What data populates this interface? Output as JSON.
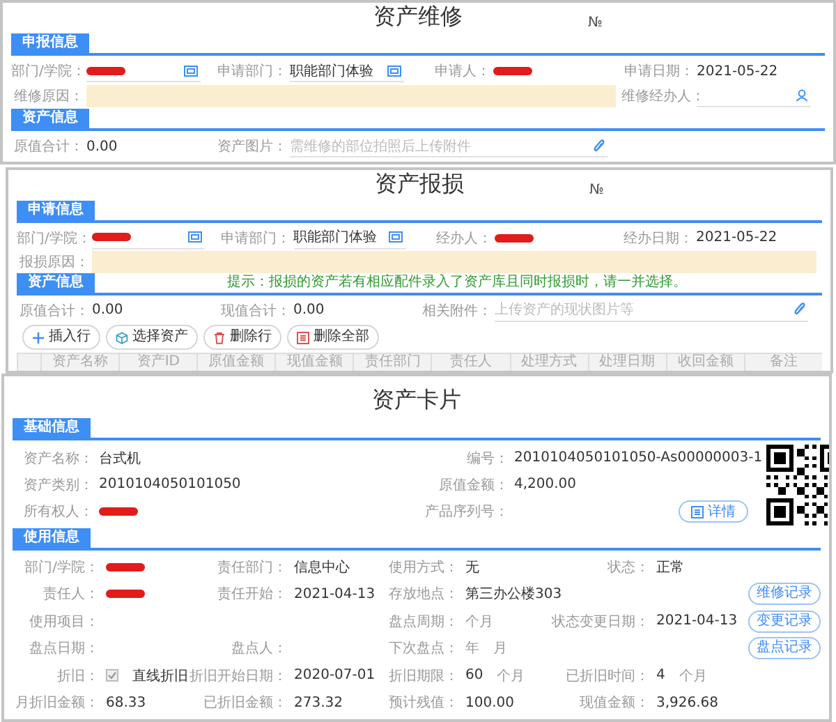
{
  "repair_form": {
    "title": "资产维修",
    "number_label": "№",
    "sections": [
      {
        "title": "申报信息",
        "rows": [
          {
            "fields": [
              {
                "label": "部门/学院：",
                "kind": "picker",
                "redacted": true
              },
              {
                "label": "申请部门：",
                "kind": "picker",
                "value": "职能部门体验"
              },
              {
                "label": "申请人：",
                "kind": "text",
                "redacted": true
              },
              {
                "label": "申请日期：",
                "kind": "text",
                "value": "2021-05-22"
              }
            ]
          },
          {
            "fields": [
              {
                "label": "维修原因：",
                "kind": "highlight"
              },
              {
                "label": "维修经办人：",
                "kind": "person"
              }
            ]
          }
        ]
      },
      {
        "title": "资产信息",
        "rows": [
          {
            "fields": [
              {
                "label": "原值合计：",
                "kind": "text",
                "value": "0.00"
              },
              {
                "label": "资产图片：",
                "kind": "attachment",
                "placeholder": "需维修的部位拍照后上传附件"
              }
            ]
          }
        ]
      }
    ]
  },
  "scrap_form": {
    "title": "资产报损",
    "number_label": "№",
    "sections": [
      {
        "title": "申请信息",
        "rows": [
          {
            "fields": [
              {
                "label": "部门/学院：",
                "kind": "picker",
                "redacted": true
              },
              {
                "label": "申请部门：",
                "kind": "picker",
                "value": "职能部门体验"
              },
              {
                "label": "经办人：",
                "kind": "text",
                "redacted": true
              },
              {
                "label": "经办日期：",
                "kind": "text",
                "value": "2021-05-22"
              }
            ]
          },
          {
            "fields": [
              {
                "label": "报损原因：",
                "kind": "highlight"
              }
            ]
          }
        ]
      },
      {
        "title": "资产信息",
        "hint": "提示：报损的资产若有相应配件录入了资产库且同时报损时，请一并选择。",
        "rows": [
          {
            "fields": [
              {
                "label": "原值合计：",
                "kind": "text",
                "value": "0.00"
              },
              {
                "label": "现值合计：",
                "kind": "text",
                "value": "0.00"
              },
              {
                "label": "相关附件：",
                "kind": "attachment",
                "placeholder": "上传资产的现状图片等"
              }
            ]
          }
        ]
      }
    ],
    "buttons": [
      {
        "label": "插入行",
        "kind": "add"
      },
      {
        "label": "选择资产",
        "kind": "select"
      },
      {
        "label": "删除行",
        "kind": "delete"
      },
      {
        "label": "删除全部",
        "kind": "delete_all"
      }
    ],
    "table": {
      "columns": [
        "资产名称",
        "资产ID",
        "原值金额",
        "现值金额",
        "责任部门",
        "责任人",
        "处理方式",
        "处理日期",
        "收回金额",
        "备注"
      ]
    }
  },
  "asset_card": {
    "title": "资产卡片",
    "basic": {
      "title": "基础信息",
      "rows": [
        [
          {
            "label": "资产名称：",
            "value": "台式机"
          },
          {
            "label": "编号：",
            "value": "2010104050101050-As00000003-1"
          }
        ],
        [
          {
            "label": "资产类别：",
            "value": "2010104050101050"
          },
          {
            "label": "原值金额：",
            "value": "4,200.00"
          }
        ],
        [
          {
            "label": "所有权人：",
            "redacted": true
          },
          {
            "label": "产品序列号："
          }
        ]
      ],
      "detail_button": "详情"
    },
    "usage": {
      "title": "使用信息",
      "rows": [
        {
          "fields": [
            {
              "label": "部门/学院：",
              "redacted": true
            },
            {
              "label": "责任部门：",
              "value": "信息中心"
            },
            {
              "label": "使用方式：",
              "value": "无"
            },
            {
              "label": "状态：",
              "value": "正常"
            }
          ]
        },
        {
          "fields": [
            {
              "label": "责任人：",
              "redacted": true
            },
            {
              "label": "责任开始：",
              "value": "2021-04-13"
            },
            {
              "label": "存放地点：",
              "value": "第三办公楼303"
            }
          ],
          "button": "维修记录"
        },
        {
          "fields": [
            {
              "label": "使用项目：",
              "kind": "wide"
            },
            {
              "label": "盘点周期：",
              "units": [
                "个月"
              ]
            },
            {
              "label": "状态变更日期：",
              "value": "2021-04-13"
            }
          ],
          "button": "变更记录"
        },
        {
          "fields": [
            {
              "label": "盘点日期："
            },
            {
              "label": "盘点人："
            },
            {
              "label": "下次盘点：",
              "units": [
                "年",
                "月"
              ]
            }
          ],
          "button": "盘点记录"
        },
        {
          "fields": [
            {
              "label": "折旧：",
              "kind": "checkbox",
              "checked": true,
              "value": "直线折旧"
            },
            {
              "label": "折旧开始日期：",
              "value": "2020-07-01"
            },
            {
              "label": "折旧期限：",
              "value": "60",
              "units": [
                "个月"
              ]
            },
            {
              "label": "已折旧时间：",
              "value": "4",
              "units": [
                "个月"
              ]
            }
          ]
        },
        {
          "fields": [
            {
              "label": "月折旧金额：",
              "value": "68.33"
            },
            {
              "label": "已折旧金额：",
              "value": "273.32"
            },
            {
              "label": "预计残值：",
              "value": "100.00"
            },
            {
              "label": "现值金额：",
              "value": "3,926.68"
            }
          ]
        }
      ]
    }
  }
}
